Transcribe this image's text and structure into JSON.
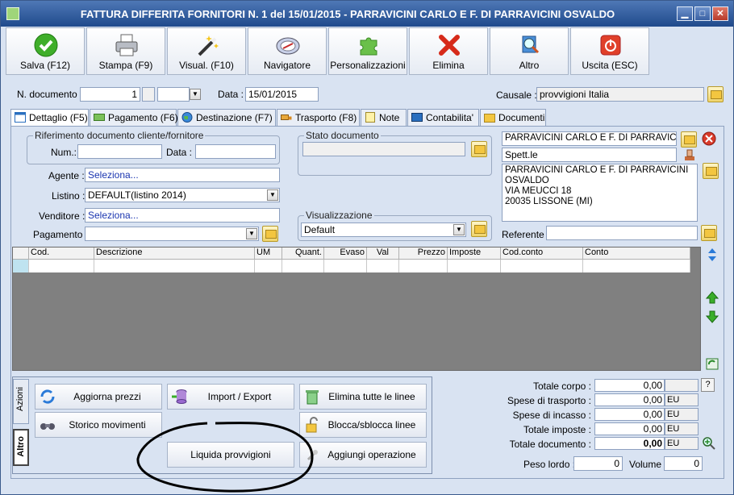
{
  "window": {
    "title": "FATTURA DIFFERITA FORNITORI N. 1 del 15/01/2015 - PARRAVICINI CARLO E F. DI PARRAVICINI OSVALDO",
    "min": "▁",
    "max": "□",
    "close": "✕"
  },
  "toolbar": [
    {
      "label": "Salva (F12)"
    },
    {
      "label": "Stampa (F9)"
    },
    {
      "label": "Visual. (F10)"
    },
    {
      "label": "Navigatore"
    },
    {
      "label": "Personalizzazioni"
    },
    {
      "label": "Elimina"
    },
    {
      "label": "Altro"
    },
    {
      "label": "Uscita (ESC)"
    }
  ],
  "header": {
    "num_label": "N. documento :",
    "num_value": "1",
    "num_series": "",
    "data_label": "Data :",
    "data_value": "15/01/2015",
    "causale_label": "Causale :",
    "causale_value": "provvigioni Italia"
  },
  "tabs": [
    "Dettaglio (F5)",
    "Pagamento (F6)",
    "Destinazione (F7)",
    "Trasporto (F8)",
    "Note",
    "Contabilita'",
    "Documenti"
  ],
  "rif": {
    "title": "Riferimento documento cliente/fornitore",
    "num_label": "Num.:",
    "num_value": "",
    "data_label": "Data :",
    "data_value": ""
  },
  "stato": {
    "title": "Stato documento",
    "value": ""
  },
  "fields": {
    "agente_label": "Agente :",
    "agente_value": "Seleziona...",
    "listino_label": "Listino :",
    "listino_value": "DEFAULT(listino 2014)",
    "venditore_label": "Venditore :",
    "venditore_value": "Seleziona...",
    "pagamento_label": "Pagamento :",
    "pagamento_value": ""
  },
  "visual": {
    "title": "Visualizzazione",
    "value": "Default"
  },
  "customer": {
    "name": "PARRAVICINI CARLO E F. DI PARRAVICINI",
    "salutation": "Spett.le",
    "address": [
      "PARRAVICINI CARLO E F. DI PARRAVICINI",
      "OSVALDO",
      "VIA MEUCCI 18",
      "20035 LISSONE (MI)"
    ],
    "referente_label": "Referente",
    "referente_value": ""
  },
  "grid": {
    "columns": [
      "Cod.",
      "Descrizione",
      "UM",
      "Quant.",
      "Evaso",
      "Val",
      "Prezzo",
      "Imposte",
      "Cod.conto",
      "Conto"
    ]
  },
  "actions": {
    "vtabs": [
      "Azioni",
      "Altro"
    ],
    "buttons": [
      "Aggiorna prezzi",
      "Import / Export",
      "Elimina tutte le linee",
      "Storico movimenti",
      "Blocca/sblocca linee",
      "Liquida provvigioni",
      "Aggiungi operazione"
    ]
  },
  "totals": {
    "corpo_label": "Totale corpo :",
    "corpo": "0,00",
    "help": "?",
    "trasporto_label": "Spese di trasporto :",
    "trasporto": "0,00",
    "incasso_label": "Spese di incasso :",
    "incasso": "0,00",
    "imposte_label": "Totale imposte :",
    "imposte": "0,00",
    "documento_label": "Totale documento :",
    "documento": "0,00",
    "currency": "EU",
    "peso_label": "Peso lordo :",
    "peso": "0",
    "volume_label": "Volume :",
    "volume": "0"
  },
  "colors": {
    "accent": "#1f4a8c",
    "panel": "#d9e3f2",
    "annotation": "#000000"
  }
}
